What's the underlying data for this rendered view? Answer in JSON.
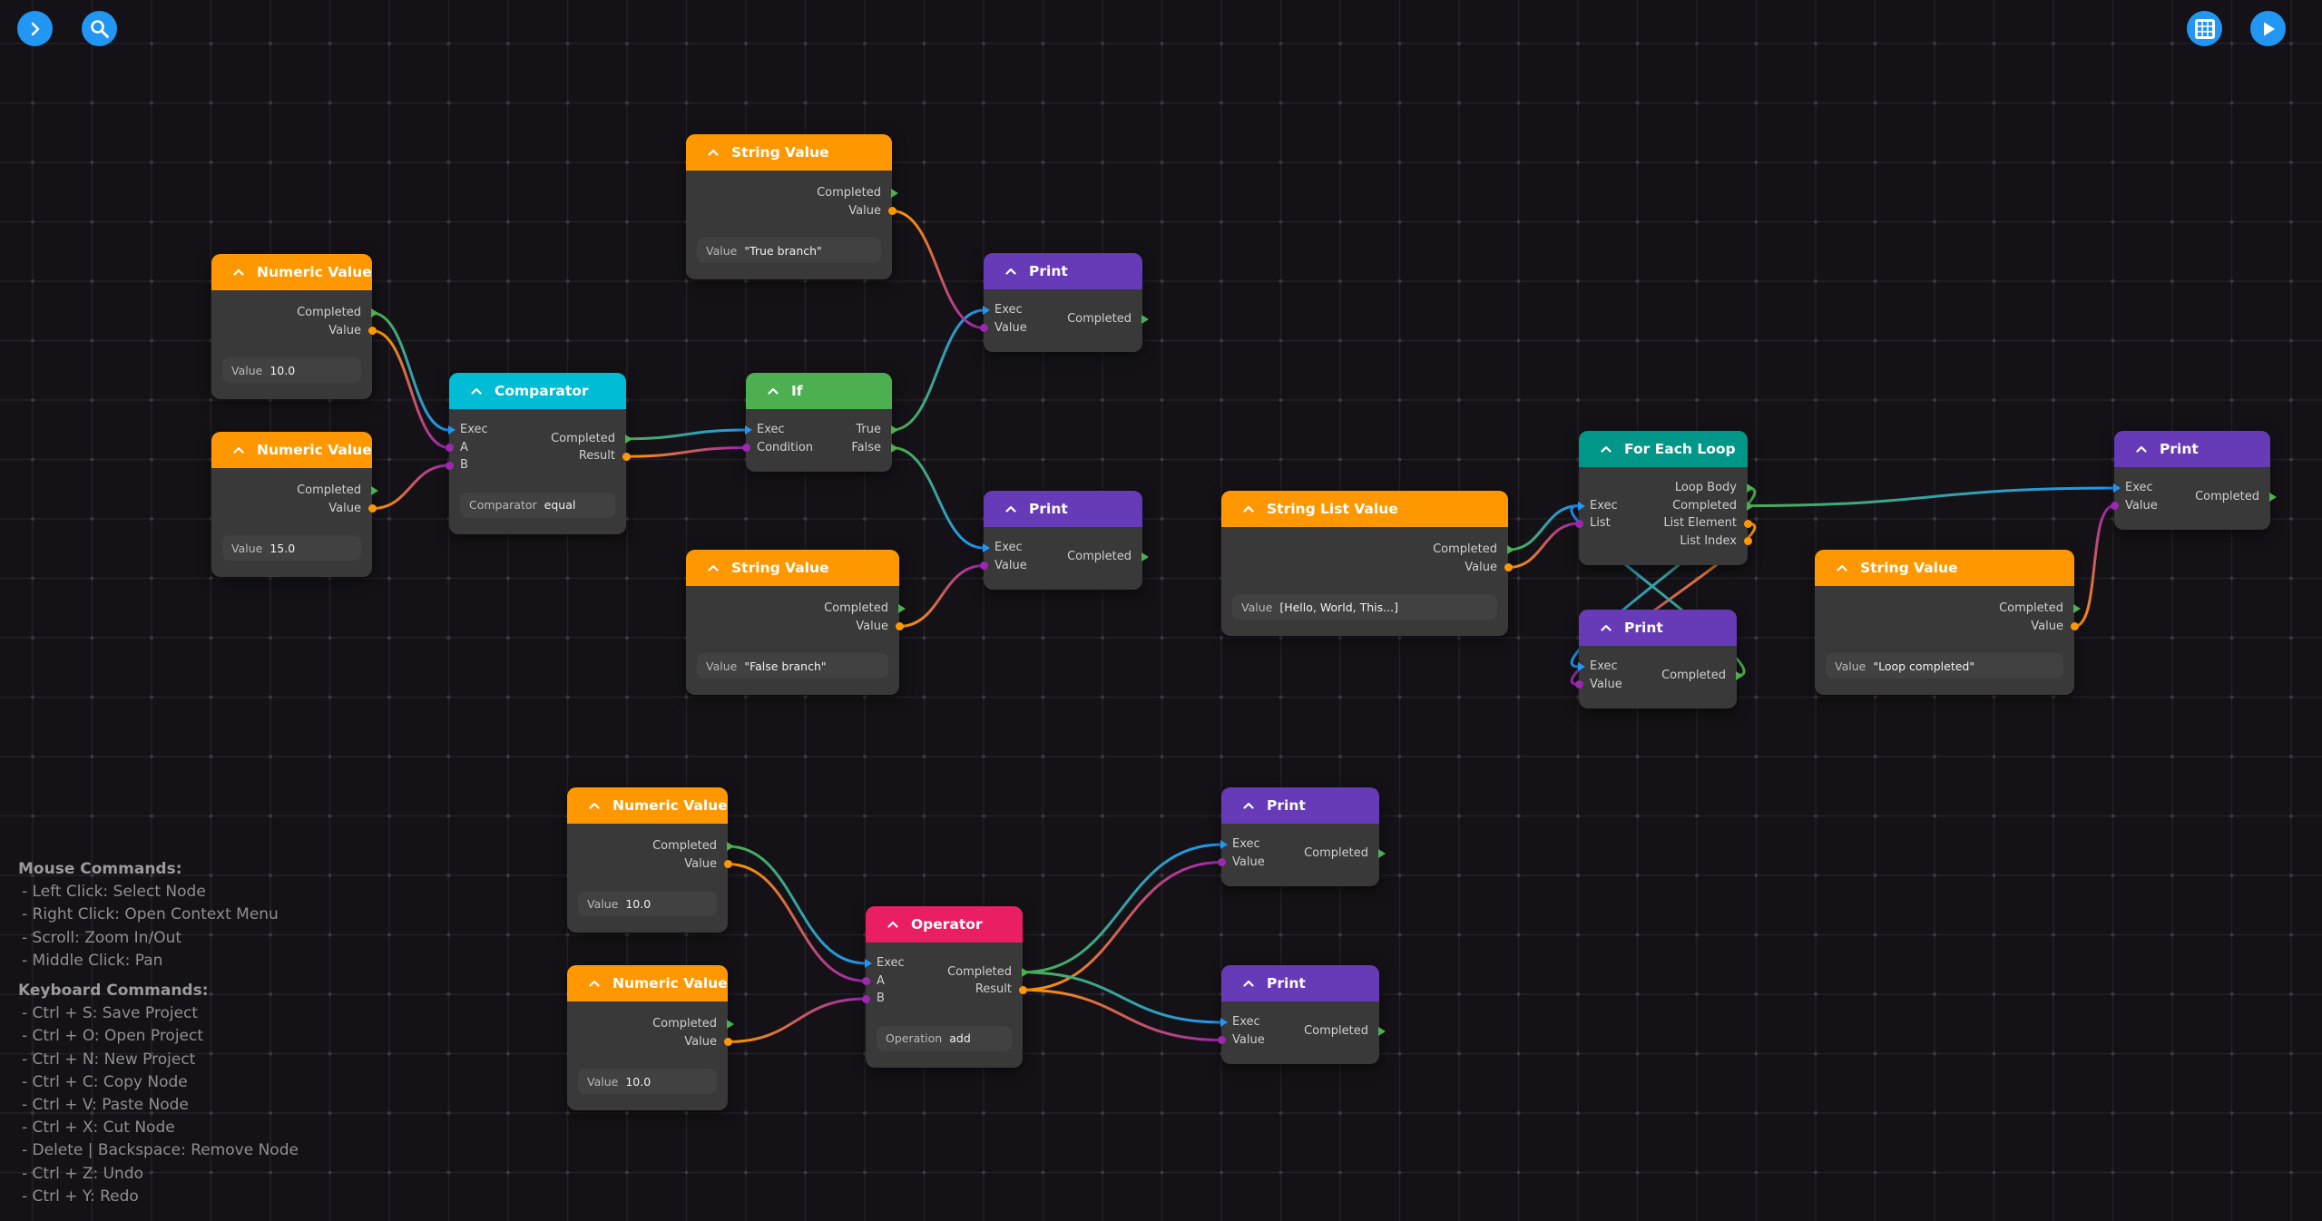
{
  "toolbar": {
    "left": [
      {
        "name": "expand-sidebar-button",
        "icon": "chevron-right-icon"
      },
      {
        "name": "search-button",
        "icon": "search-icon"
      }
    ],
    "right": [
      {
        "name": "grid-toggle-button",
        "icon": "grid-icon"
      },
      {
        "name": "run-button",
        "icon": "play-icon"
      }
    ]
  },
  "colors": {
    "background": "#141217",
    "node_body": "#393939",
    "value_header": "#ff9800",
    "comparator_header": "#00bcd4",
    "if_header": "#4caf50",
    "print_header": "#673ab7",
    "loop_header": "#009688",
    "operator_header": "#e91e63",
    "exec_out": "#4caf50",
    "exec_in": "#2196f3",
    "data_out": "#ff9800",
    "data_in": "#9c27b0",
    "fab": "#2196f3"
  },
  "nodes": [
    {
      "id": "num1",
      "title": "Numeric Value",
      "kind": "value",
      "inputs": [],
      "outputs": [
        "Completed",
        "Value"
      ],
      "prop": {
        "label": "Value",
        "value": "10.0"
      }
    },
    {
      "id": "num2",
      "title": "Numeric Value",
      "kind": "value",
      "inputs": [],
      "outputs": [
        "Completed",
        "Value"
      ],
      "prop": {
        "label": "Value",
        "value": "15.0"
      }
    },
    {
      "id": "cmp",
      "title": "Comparator",
      "kind": "comparator",
      "inputs": [
        "Exec",
        "A",
        "B"
      ],
      "outputs": [
        "Completed",
        "Result"
      ],
      "prop": {
        "label": "Comparator",
        "value": "equal"
      }
    },
    {
      "id": "strTrue",
      "title": "String Value",
      "kind": "value",
      "inputs": [],
      "outputs": [
        "Completed",
        "Value"
      ],
      "prop": {
        "label": "Value",
        "value": "\"True branch\""
      }
    },
    {
      "id": "if",
      "title": "If",
      "kind": "if",
      "inputs": [
        "Exec",
        "Condition"
      ],
      "outputs": [
        "True",
        "False"
      ]
    },
    {
      "id": "print1",
      "title": "Print",
      "kind": "print",
      "inputs": [
        "Exec",
        "Value"
      ],
      "outputs": [
        "Completed"
      ]
    },
    {
      "id": "strFalse",
      "title": "String Value",
      "kind": "value",
      "inputs": [],
      "outputs": [
        "Completed",
        "Value"
      ],
      "prop": {
        "label": "Value",
        "value": "\"False branch\""
      }
    },
    {
      "id": "print2",
      "title": "Print",
      "kind": "print",
      "inputs": [
        "Exec",
        "Value"
      ],
      "outputs": [
        "Completed"
      ]
    },
    {
      "id": "strList",
      "title": "String List Value",
      "kind": "value",
      "inputs": [],
      "outputs": [
        "Completed",
        "Value"
      ],
      "prop": {
        "label": "Value",
        "value": "[Hello, World, This...]"
      }
    },
    {
      "id": "loop",
      "title": "For Each Loop",
      "kind": "loop",
      "inputs": [
        "Exec",
        "List"
      ],
      "outputs": [
        "Loop Body",
        "Completed",
        "List Element",
        "List Index"
      ]
    },
    {
      "id": "printLoop",
      "title": "Print",
      "kind": "print",
      "inputs": [
        "Exec",
        "Value"
      ],
      "outputs": [
        "Completed"
      ]
    },
    {
      "id": "strDone",
      "title": "String Value",
      "kind": "value",
      "inputs": [],
      "outputs": [
        "Completed",
        "Value"
      ],
      "prop": {
        "label": "Value",
        "value": "\"Loop completed\""
      }
    },
    {
      "id": "printDone",
      "title": "Print",
      "kind": "print",
      "inputs": [
        "Exec",
        "Value"
      ],
      "outputs": [
        "Completed"
      ]
    },
    {
      "id": "num3",
      "title": "Numeric Value",
      "kind": "value",
      "inputs": [],
      "outputs": [
        "Completed",
        "Value"
      ],
      "prop": {
        "label": "Value",
        "value": "10.0"
      }
    },
    {
      "id": "num4",
      "title": "Numeric Value",
      "kind": "value",
      "inputs": [],
      "outputs": [
        "Completed",
        "Value"
      ],
      "prop": {
        "label": "Value",
        "value": "10.0"
      }
    },
    {
      "id": "op",
      "title": "Operator",
      "kind": "operator",
      "inputs": [
        "Exec",
        "A",
        "B"
      ],
      "outputs": [
        "Completed",
        "Result"
      ],
      "prop": {
        "label": "Operation",
        "value": "add"
      }
    },
    {
      "id": "print3",
      "title": "Print",
      "kind": "print",
      "inputs": [
        "Exec",
        "Value"
      ],
      "outputs": [
        "Completed"
      ]
    },
    {
      "id": "print4",
      "title": "Print",
      "kind": "print",
      "inputs": [
        "Exec",
        "Value"
      ],
      "outputs": [
        "Completed"
      ]
    }
  ],
  "connections": [
    {
      "from": "num1.Completed",
      "to": "cmp.Exec"
    },
    {
      "from": "num1.Value",
      "to": "cmp.A"
    },
    {
      "from": "num2.Value",
      "to": "cmp.B"
    },
    {
      "from": "cmp.Completed",
      "to": "if.Exec"
    },
    {
      "from": "cmp.Result",
      "to": "if.Condition"
    },
    {
      "from": "if.True",
      "to": "print1.Exec"
    },
    {
      "from": "strTrue.Value",
      "to": "print1.Value"
    },
    {
      "from": "if.False",
      "to": "print2.Exec"
    },
    {
      "from": "strFalse.Value",
      "to": "print2.Value"
    },
    {
      "from": "strList.Completed",
      "to": "loop.Exec"
    },
    {
      "from": "strList.Value",
      "to": "loop.List"
    },
    {
      "from": "loop.Loop Body",
      "to": "printLoop.Exec"
    },
    {
      "from": "loop.List Element",
      "to": "printLoop.Value"
    },
    {
      "from": "printLoop.Completed",
      "to": "loop.Exec"
    },
    {
      "from": "loop.Completed",
      "to": "printDone.Exec"
    },
    {
      "from": "strDone.Value",
      "to": "printDone.Value"
    },
    {
      "from": "num3.Completed",
      "to": "op.Exec"
    },
    {
      "from": "num3.Value",
      "to": "op.A"
    },
    {
      "from": "num4.Value",
      "to": "op.B"
    },
    {
      "from": "op.Completed",
      "to": "print3.Exec"
    },
    {
      "from": "op.Result",
      "to": "print3.Value"
    },
    {
      "from": "op.Completed",
      "to": "print4.Exec"
    },
    {
      "from": "op.Result",
      "to": "print4.Value"
    }
  ],
  "help": {
    "mouse_title": "Mouse Commands:",
    "mouse": [
      "- Left Click: Select Node",
      "- Right Click: Open Context Menu",
      "- Scroll: Zoom In/Out",
      "- Middle Click: Pan"
    ],
    "keyboard_title": "Keyboard Commands:",
    "keyboard": [
      "- Ctrl + S: Save Project",
      "- Ctrl + O: Open Project",
      "- Ctrl + N: New Project",
      "- Ctrl + C: Copy Node",
      "- Ctrl + V: Paste Node",
      "- Ctrl + X: Cut Node",
      "- Delete | Backspace: Remove Node",
      "- Ctrl + Z: Undo",
      "- Ctrl + Y: Redo"
    ]
  }
}
